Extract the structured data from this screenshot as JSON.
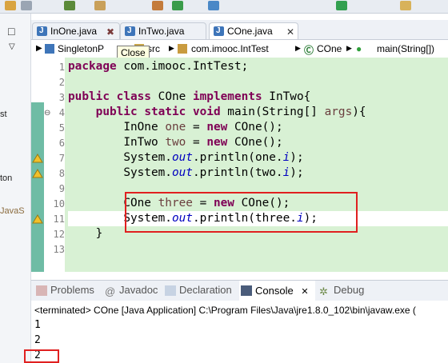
{
  "toolbar": {
    "icons": [
      "new-icon",
      "save-icon",
      "debug-icon",
      "run-icon",
      "external-tools-icon",
      "open-type-icon",
      "search-icon",
      "back-icon",
      "forward-icon"
    ]
  },
  "left_panel": {
    "fragments": [
      "st",
      "ton",
      "JavaS"
    ]
  },
  "editor_tabs": [
    {
      "label": "InOne.java",
      "active": false
    },
    {
      "label": "InTwo.java",
      "active": false
    },
    {
      "label": "COne.java",
      "active": true
    }
  ],
  "tooltip": "Close",
  "breadcrumb": {
    "project": "SingletonP",
    "folder": "src",
    "package": "com.imooc.IntTest",
    "class": "COne",
    "method": "main(String[])"
  },
  "code": {
    "line_numbers": [
      "1",
      "2",
      "3",
      "4",
      "5",
      "6",
      "7",
      "8",
      "9",
      "10",
      "11",
      "12",
      "13"
    ],
    "l1": {
      "kw": "package",
      "rest": " com.imooc.IntTest;"
    },
    "l3": {
      "kw1": "public",
      "kw2": "class",
      "name": "COne",
      "kw3": "implements",
      "iface": "InTwo{"
    },
    "l4": {
      "kw1": "public",
      "kw2": "static",
      "kw3": "void",
      "rest": "main(String[] ",
      "arg": "args",
      "end": "){"
    },
    "l5": {
      "type": "InOne",
      "var": "one",
      "eq": " = ",
      "kw": "new",
      "rest": " COne();"
    },
    "l6": {
      "type": "InTwo",
      "var": "two",
      "eq": " = ",
      "kw": "new",
      "rest": " COne();"
    },
    "l7": {
      "pre": "System.",
      "out": "out",
      "mid": ".println(one.",
      "fld": "i",
      "end": ");"
    },
    "l8": {
      "pre": "System.",
      "out": "out",
      "mid": ".println(two.",
      "fld": "i",
      "end": ");"
    },
    "l10": {
      "type": "COne",
      "var": "three",
      "eq": " = ",
      "kw": "new",
      "rest": " COne();"
    },
    "l11": {
      "pre": "System.",
      "out": "out",
      "mid": ".println(three.",
      "fld": "i",
      "end": ");"
    },
    "l12": "}"
  },
  "bottom_tabs": [
    {
      "label": "Problems",
      "active": false
    },
    {
      "label": "Javadoc",
      "active": false
    },
    {
      "label": "Declaration",
      "active": false
    },
    {
      "label": "Console",
      "active": true
    },
    {
      "label": "Debug",
      "active": false
    }
  ],
  "console": {
    "status": "<terminated> COne [Java Application] C:\\Program Files\\Java\\jre1.8.0_102\\bin\\javaw.exe (",
    "output": [
      "1",
      "2",
      "2"
    ]
  },
  "colors": {
    "code_bg": "#d8f1d4",
    "keyword": "#7f0055",
    "field": "#0000c0",
    "highlight_box": "#e02020"
  }
}
